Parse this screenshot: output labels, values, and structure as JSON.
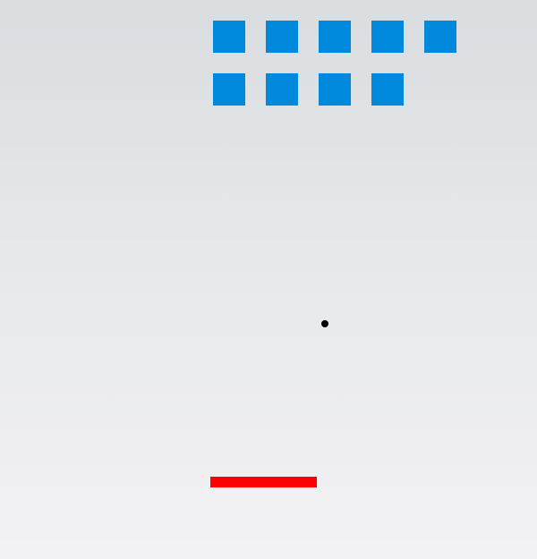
{
  "game": {
    "colors": {
      "brick": "#0088dd",
      "ball": "#000000",
      "paddle": "#ff0000",
      "background_top": "#d9dde0",
      "background_bottom": "#f2f2f4"
    },
    "bricks_remaining": 9
  }
}
